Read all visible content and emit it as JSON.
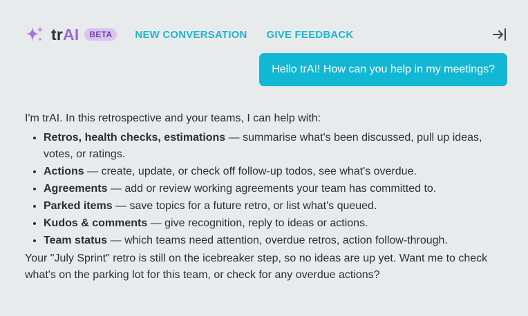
{
  "header": {
    "brand_tr": "tr",
    "brand_ai": "AI",
    "beta_label": "BETA",
    "new_conversation": "NEW CONVERSATION",
    "give_feedback": "GIVE FEEDBACK"
  },
  "user_message": "Hello trAI! How can you help in my meetings?",
  "assistant": {
    "intro": "I'm trAI. In this retrospective and your teams, I can help with:",
    "items": [
      {
        "title": "Retros, health checks, estimations",
        "text": " — summarise what's been discussed, pull up ideas, votes, or ratings."
      },
      {
        "title": "Actions",
        "text": " — create, update, or check off follow-up todos, see what's overdue."
      },
      {
        "title": "Agreements",
        "text": " — add or review working agreements your team has committed to."
      },
      {
        "title": "Parked items",
        "text": " — save topics for a future retro, or list what's queued."
      },
      {
        "title": "Kudos & comments",
        "text": " — give recognition, reply to ideas or actions."
      },
      {
        "title": "Team status",
        "text": " — which teams need attention, overdue retros, action follow-through."
      }
    ],
    "outro": "Your \"July Sprint\" retro is still on the icebreaker step, so no ideas are up yet. Want me to check what's on the parking lot for this team, or check for any overdue actions?"
  },
  "colors": {
    "accent": "#12b7d4",
    "brand_purple": "#9b6bd1",
    "beta_bg": "#d9c4ef",
    "background": "#e8ebec"
  },
  "icons": {
    "logo": "sparkles-icon",
    "collapse": "collapse-panel-icon"
  }
}
